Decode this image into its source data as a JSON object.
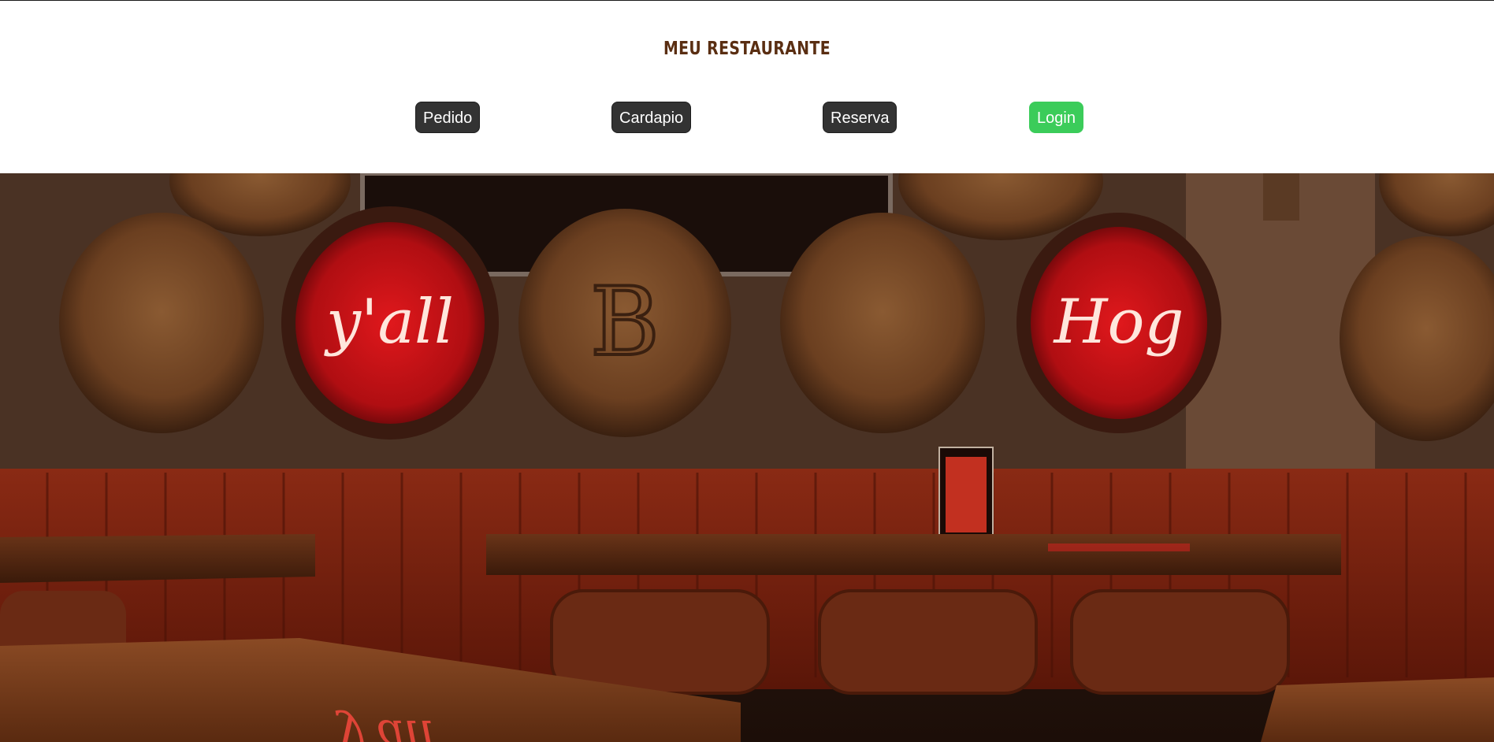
{
  "header": {
    "title": "MEU RESTAURANTE"
  },
  "nav": {
    "pedido": "Pedido",
    "cardapio": "Cardapio",
    "reserva": "Reserva",
    "login": "Login"
  },
  "colors": {
    "title": "#5a2e12",
    "button": "#333333",
    "login_button": "#3bcc5a"
  },
  "hero": {
    "neon_sign_left": "y'all",
    "neon_sign_right": "Hog",
    "barrel_letter": "B"
  }
}
